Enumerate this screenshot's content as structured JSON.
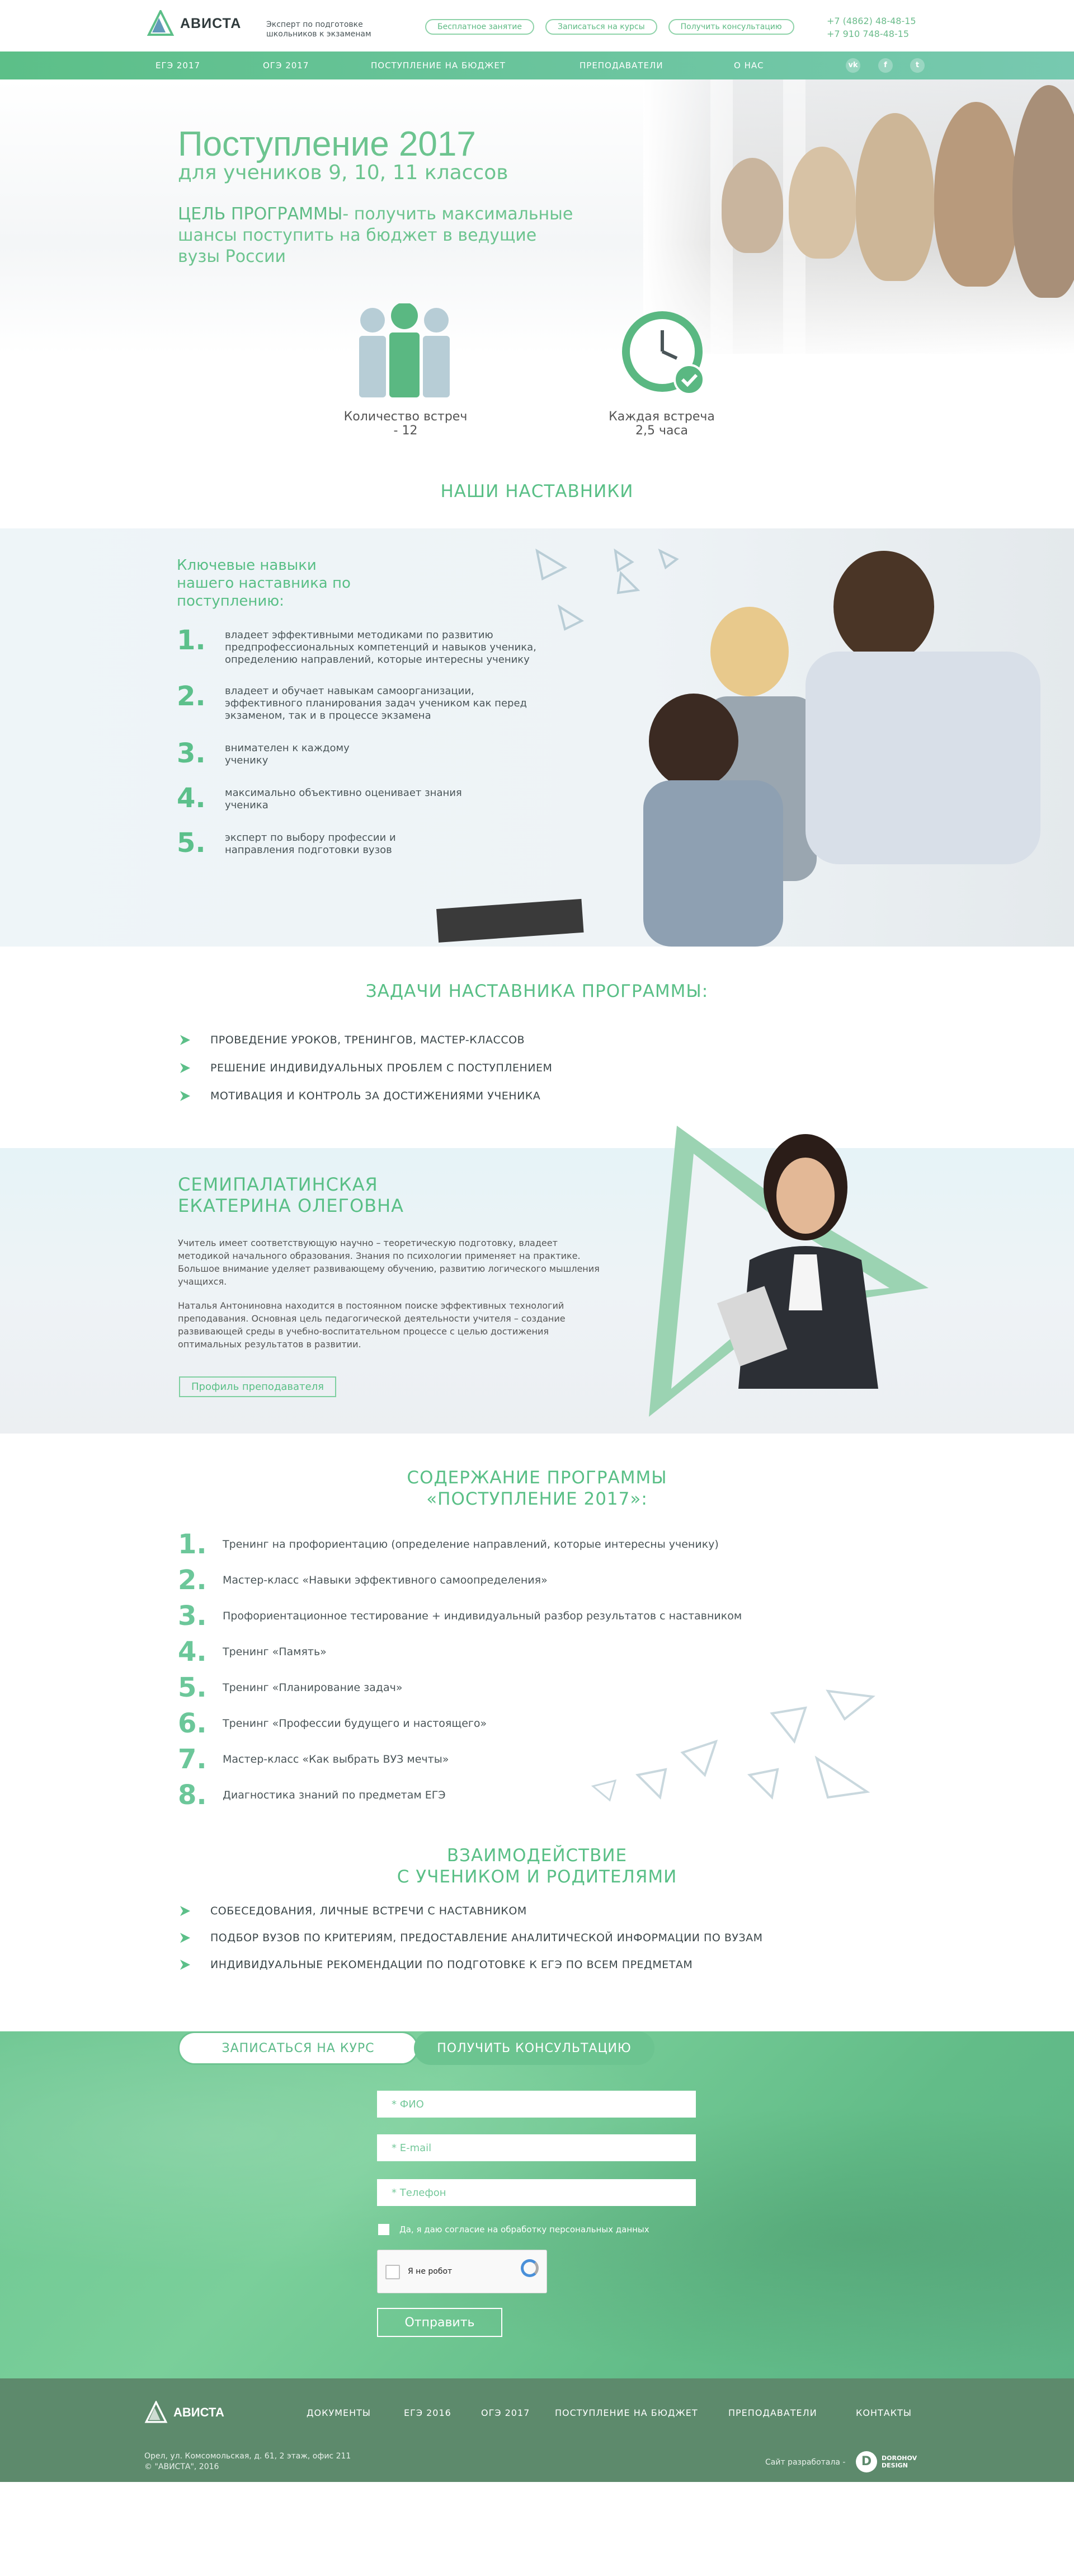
{
  "brand": {
    "name": "АВИСТА",
    "tagline": "Эксперт по подготовке школьников к экзаменам",
    "accent": "#5cbf88"
  },
  "header": {
    "buttons": [
      "Бесплатное занятие",
      "Записаться на курсы",
      "Получить консультацию"
    ],
    "phones": [
      "+7 (4862) 48-48-15",
      "+7 910 748-48-15"
    ]
  },
  "nav": {
    "items": [
      "ЕГЭ 2017",
      "ОГЭ 2017",
      "ПОСТУПЛЕНИЕ НА БЮДЖЕТ",
      "ПРЕПОДАВАТЕЛИ",
      "О НАС"
    ],
    "social": [
      "vk-icon",
      "facebook-icon",
      "twitter-icon"
    ]
  },
  "hero": {
    "title": "Поступление 2017",
    "subtitle": "для учеников 9, 10, 11 классов",
    "goal_label": "ЦЕЛЬ ПРОГРАММЫ",
    "goal_text": "- получить максимальные шансы поступить на бюджет в ведущие вузы России"
  },
  "stats": [
    {
      "label": "Количество встреч - 12"
    },
    {
      "label": "Каждая встреча 2,5 часа"
    }
  ],
  "mentors": {
    "title": "НАШИ НАСТАВНИКИ",
    "heading": "Ключевые навыки нашего наставника по поступлению:",
    "skills": [
      {
        "num": "1.",
        "text": "владеет эффективными методиками по развитию предпрофессиональных компетенций и навыков ученика, определению направлений, которые интересны ученику"
      },
      {
        "num": "2.",
        "text": "владеет и обучает навыкам самоорганизации, эффективного планирования задач учеником как перед экзаменом, так и в процессе экзамена"
      },
      {
        "num": "3.",
        "text": "внимателен к каждому ученику"
      },
      {
        "num": "4.",
        "text": "максимально объективно оценивает знания ученика"
      },
      {
        "num": "5.",
        "text": "эксперт по выбору профессии и направления подготовки вузов"
      }
    ]
  },
  "tasks": {
    "title": "ЗАДАЧИ НАСТАВНИКА ПРОГРАММЫ:",
    "items": [
      "ПРОВЕДЕНИЕ УРОКОВ, ТРЕНИНГОВ, МАСТЕР-КЛАССОВ",
      "РЕШЕНИЕ ИНДИВИДУАЛЬНЫХ ПРОБЛЕМ С ПОСТУПЛЕНИЕМ",
      "МОТИВАЦИЯ И КОНТРОЛЬ ЗА ДОСТИЖЕНИЯМИ УЧЕНИКА"
    ]
  },
  "teacher": {
    "name_line1": "СЕМИПАЛАТИНСКАЯ",
    "name_line2": "ЕКАТЕРИНА ОЛЕГОВНА",
    "para1": "Учитель имеет соответствующую научно – теоретическую подготовку, владеет методикой начального образования. Знания по психологии применяет на практике. Большое внимание уделяет развивающему обучению, развитию логического мышления учащихся.",
    "para2": "Наталья Антониновна находится в постоянном поиске эффективных технологий преподавания. Основная цель педагогической деятельности учителя – создание развивающей среды в учебно-воспитательном процессе с целью достижения оптимальных результатов в развитии.",
    "button": "Профиль преподавателя"
  },
  "program": {
    "title_line1": "СОДЕРЖАНИЕ ПРОГРАММЫ",
    "title_line2": "«ПОСТУПЛЕНИЕ 2017»:",
    "items": [
      {
        "num": "1.",
        "text": "Тренинг на профориентацию (определение направлений, которые интересны ученику)"
      },
      {
        "num": "2.",
        "text": "Мастер-класс «Навыки эффективного самоопределения»"
      },
      {
        "num": "3.",
        "text": "Профориентационное тестирование + индивидуальный разбор результатов с наставником"
      },
      {
        "num": "4.",
        "text": "Тренинг «Память»"
      },
      {
        "num": "5.",
        "text": "Тренинг «Планирование задач»"
      },
      {
        "num": "6.",
        "text": "Тренинг «Профессии будущего и настоящего»"
      },
      {
        "num": "7.",
        "text": "Мастер-класс «Как выбрать ВУЗ мечты»"
      },
      {
        "num": "8.",
        "text": "Диагностика знаний по предметам ЕГЭ"
      }
    ]
  },
  "interaction": {
    "title_line1": "ВЗАИМОДЕЙСТВИЕ",
    "title_line2": "С УЧЕНИКОМ И РОДИТЕЛЯМИ",
    "items": [
      "СОБЕСЕДОВАНИЯ, ЛИЧНЫЕ ВСТРЕЧИ С НАСТАВНИКОМ",
      "ПОДБОР ВУЗОВ ПО КРИТЕРИЯМ, ПРЕДОСТАВЛЕНИЕ АНАЛИТИЧЕСКОЙ ИНФОРМАЦИИ ПО ВУЗАМ",
      "ИНДИВИДУАЛЬНЫЕ РЕКОМЕНДАЦИИ ПО ПОДГОТОВКЕ К ЕГЭ ПО ВСЕМ ПРЕДМЕТАМ"
    ]
  },
  "form": {
    "tab_signup": "ЗАПИСАТЬСЯ НА КУРС",
    "tab_consult": "ПОЛУЧИТЬ КОНСУЛЬТАЦИЮ",
    "name_placeholder": "* ФИО",
    "email_placeholder": "* E-mail",
    "phone_placeholder": "* Телефон",
    "consent": "Да, я даю согласие на обработку персональных данных",
    "captcha": "Я не робот",
    "submit": "Отправить"
  },
  "footer": {
    "items": [
      "ДОКУМЕНТЫ",
      "ЕГЭ 2016",
      "ОГЭ 2017",
      "ПОСТУПЛЕНИЕ НА БЮДЖЕТ",
      "ПРЕПОДАВАТЕЛИ",
      "КОНТАКТЫ"
    ],
    "address_line1": "Орел, ул. Комсомольская, д. 61, 2 этаж, офис 211",
    "address_line2": "© \"АВИСТА\", 2016",
    "developer": "Сайт разработала -",
    "developer_name": "DOROHOV DESIGN"
  }
}
